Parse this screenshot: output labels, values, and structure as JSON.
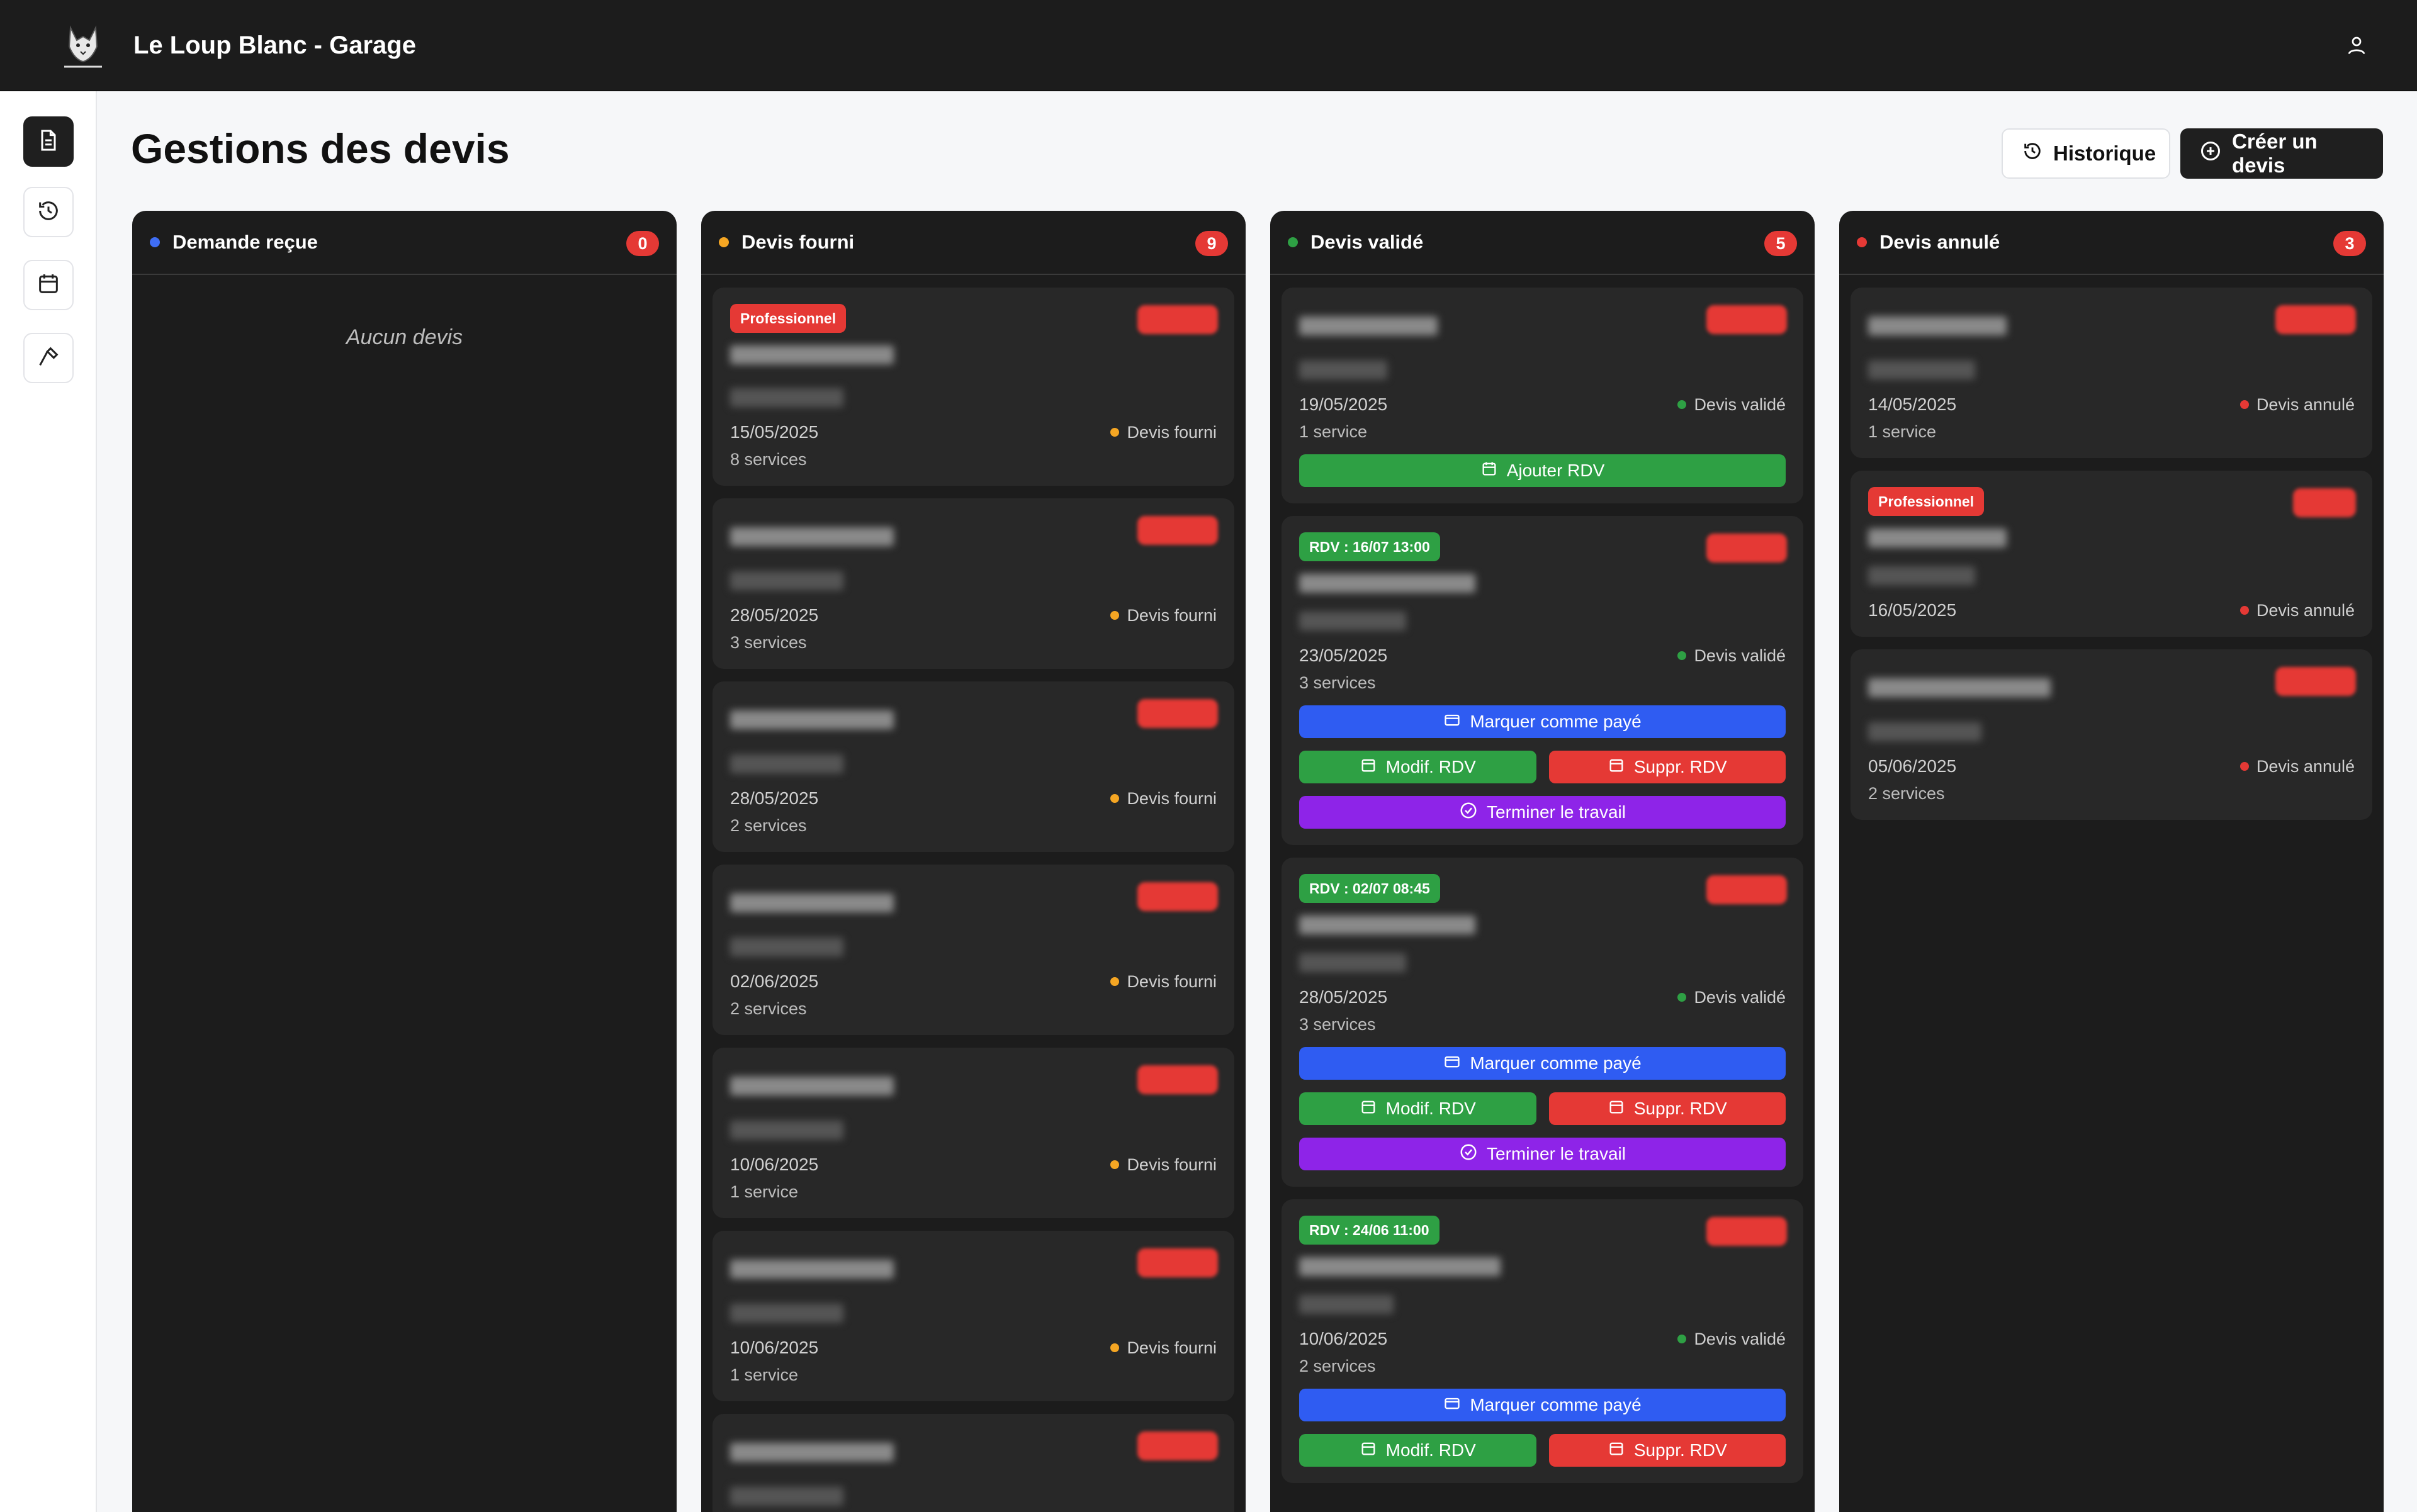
{
  "app": {
    "title": "Le Loup Blanc - Garage"
  },
  "page": {
    "title": "Gestions des devis",
    "history_label": "Historique",
    "create_label": "Créer un devis"
  },
  "icons": {
    "user": "user-icon",
    "doc": "document-icon",
    "history": "history-icon",
    "calendar": "calendar-icon",
    "tool": "hammer-icon",
    "plus": "plus-circle-icon",
    "check": "check-circle-icon",
    "card": "credit-card-icon"
  },
  "colors": {
    "blue": "#3f6ef5",
    "orange": "#f5a623",
    "green": "#2ea044",
    "red": "#e53935",
    "purple": "#8e24e8"
  },
  "columns": {
    "received": {
      "title": "Demande reçue",
      "count": "0",
      "empty": "Aucun devis"
    },
    "provided": {
      "title": "Devis fourni",
      "count": "9",
      "cards": [
        {
          "tag": "Professionnel",
          "date": "15/05/2025",
          "status": "Devis fourni",
          "services": "8 services"
        },
        {
          "date": "28/05/2025",
          "status": "Devis fourni",
          "services": "3 services"
        },
        {
          "date": "28/05/2025",
          "status": "Devis fourni",
          "services": "2 services"
        },
        {
          "date": "02/06/2025",
          "status": "Devis fourni",
          "services": "2 services"
        },
        {
          "date": "10/06/2025",
          "status": "Devis fourni",
          "services": "1 service"
        },
        {
          "date": "10/06/2025",
          "status": "Devis fourni",
          "services": "1 service"
        },
        {}
      ]
    },
    "validated": {
      "title": "Devis validé",
      "count": "5",
      "cards": [
        {
          "date": "19/05/2025",
          "status": "Devis validé",
          "services": "1 service",
          "add_rdv": "Ajouter RDV"
        },
        {
          "rdv": "RDV : 16/07 13:00",
          "date": "23/05/2025",
          "status": "Devis validé",
          "services": "3 services"
        },
        {
          "rdv": "RDV : 02/07 08:45",
          "date": "28/05/2025",
          "status": "Devis validé",
          "services": "3 services"
        },
        {
          "rdv": "RDV : 24/06 11:00",
          "date": "10/06/2025",
          "status": "Devis validé",
          "services": "2 services"
        }
      ],
      "actions": {
        "paid": "Marquer comme payé",
        "modify": "Modif. RDV",
        "delete": "Suppr. RDV",
        "finish": "Terminer le travail"
      }
    },
    "cancelled": {
      "title": "Devis annulé",
      "count": "3",
      "cards": [
        {
          "date": "14/05/2025",
          "status": "Devis annulé",
          "services": "1 service"
        },
        {
          "tag": "Professionnel",
          "date": "16/05/2025",
          "status": "Devis annulé"
        },
        {
          "date": "05/06/2025",
          "status": "Devis annulé",
          "services": "2 services"
        }
      ]
    }
  }
}
